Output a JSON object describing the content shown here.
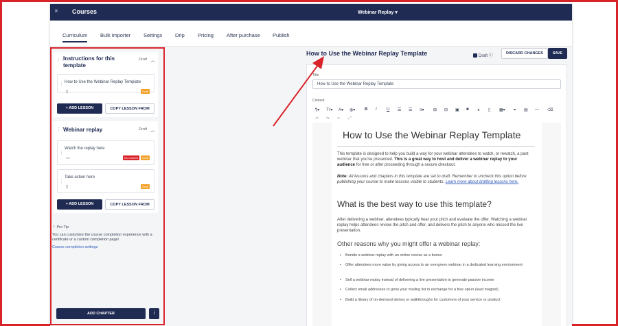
{
  "topbar": {
    "close": "×",
    "title": "Courses",
    "center": "Webinar Replay ▾"
  },
  "tabs": [
    "Curriculum",
    "Bulk importer",
    "Settings",
    "Drip",
    "Pricing",
    "After purchase",
    "Publish"
  ],
  "chapters": [
    {
      "title_line1": "Instructions for this",
      "title_line2": "template",
      "status": "Draft",
      "lessons": [
        {
          "name": "How to Use the Webinar Replay Template",
          "badges": [
            "Draft"
          ]
        }
      ],
      "add_lesson": "+ ADD LESSON",
      "copy_lesson": "COPY LESSON FROM"
    },
    {
      "title_line1": "Webinar replay",
      "status": "Draft",
      "lessons": [
        {
          "name": "Watch the replay here",
          "badges": [
            "No Content",
            "Draft"
          ]
        },
        {
          "name": "Take action here",
          "badges": [
            "Draft"
          ]
        }
      ],
      "add_lesson": "+ ADD LESSON",
      "copy_lesson": "COPY LESSON FROM"
    }
  ],
  "protip": {
    "label": "Pro Tip",
    "text": "You can customize the course completion experience with a certificate or a custom completion page!",
    "link": "Course completion settings"
  },
  "add_chapter": "ADD CHAPTER",
  "info_icon": "i",
  "lesson_editor": {
    "heading": "How to Use the Webinar Replay Template",
    "draft_label": "Draft",
    "discard": "DISCARD CHANGES",
    "save": "SAVE",
    "title_label": "Title",
    "title_value": "How to Use the Webinar Replay Template",
    "content_label": "Content"
  },
  "document": {
    "h1": "How to Use the Webinar Replay Template",
    "p1_a": "This template is designed to help you build a way for your webinar attendees to watch, or rewatch, a past webinar that you've presented. ",
    "p1_b": "This is a great way to host and deliver a webinar replay to your audience",
    "p1_c": " for free or after proceeding through a secure checkout.",
    "note_label": "Note:",
    "note_text": " All lessons and chapters in this template are set to draft. Remember to uncheck this option before publishing your course to make lessons visible to students. ",
    "note_link": "Learn more about drafting lessons here.",
    "h2": "What is the best way to use this template?",
    "p2": "After delivering a webinar, attendees typically hear your pitch and evaluate the offer. Watching a webinar replay helps attendees review the pitch and offer, and delivers the pitch to anyone who missed the live presentation.",
    "h3": "Other reasons why you might offer a webinar replay:",
    "bullets": [
      "Bundle a webinar replay with an online course as a bonus",
      "Offer attendees more value by giving access to an evergreen webinar in a dedicated learning environment",
      "Sell a webinar replay instead of delivering a live presentation to generate passive income",
      "Collect email addresses to grow your mailing list in exchange for a free opt-in (lead magnet)",
      "Build a library of on-demand demos or walkthroughs for customers of your service or product"
    ]
  },
  "colors": {
    "navy": "#1f2b52",
    "annotation_red": "#d9232a",
    "draft_badge": "#f2a12a"
  }
}
